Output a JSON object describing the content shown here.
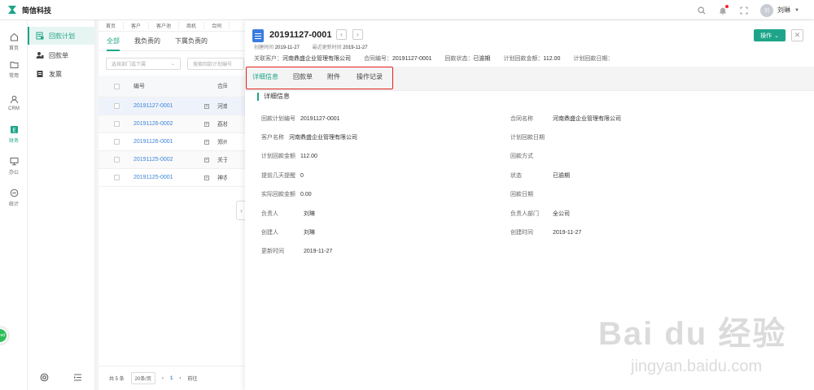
{
  "app": {
    "title": "简信科技"
  },
  "user": {
    "avatar_text": "刘",
    "name": "刘琳"
  },
  "rail": [
    {
      "label": "首页",
      "icon": "home-icon"
    },
    {
      "label": "常用",
      "icon": "folder-icon"
    },
    {
      "label": "CRM",
      "icon": "person-icon"
    },
    {
      "label": "财务",
      "icon": "finance-icon"
    },
    {
      "label": "办公",
      "icon": "monitor-icon"
    },
    {
      "label": "统计",
      "icon": "minus-circle-icon"
    }
  ],
  "chat_bubble": "ed",
  "subnav": [
    {
      "label": "回款计划",
      "active": true
    },
    {
      "label": "回款单"
    },
    {
      "label": "发票"
    }
  ],
  "breadcrumbs": [
    "首页",
    "客户",
    "客户池",
    "商机",
    "合同"
  ],
  "list_tabs": [
    "全部",
    "我负责的",
    "下属负责的"
  ],
  "filters": {
    "dept_placeholder": "选择部门或下属",
    "search_placeholder": "搜索回款计划编号"
  },
  "table": {
    "header": {
      "code": "编号",
      "name": "合同"
    },
    "rows": [
      {
        "code": "20191127-0001",
        "name": "河南"
      },
      {
        "code": "20191126-0002",
        "name": "荔枝"
      },
      {
        "code": "20191126-0001",
        "name": "郑州"
      },
      {
        "code": "20191125-0002",
        "name": "关于"
      },
      {
        "code": "20191125-0001",
        "name": "神农"
      }
    ]
  },
  "pager": {
    "total": "共 5 条",
    "page_size": "20条/页",
    "current_page": "1",
    "goto": "前往"
  },
  "detail": {
    "title": "20191127-0001",
    "created_label": "创建时间",
    "created_value": "2019-11-27",
    "updated_label": "最近更新时间",
    "updated_value": "2019-11-27",
    "op_button": "操作",
    "summary": {
      "customer_label": "关联客户：",
      "customer_value": "河南鼎盛企业管理有限公司",
      "contract_label": "合同编号：",
      "contract_value": "20191127-0001",
      "status_label": "回款状态：",
      "status_value": "已逾期",
      "amount_label": "计划回款金额：",
      "amount_value": "112.00",
      "date_label": "计划回款日期："
    },
    "tabs": [
      "详细信息",
      "回款单",
      "附件",
      "操作记录"
    ],
    "section_title": "详细信息",
    "fields_left": [
      {
        "label": "回款计划编号",
        "value": "20191127-0001"
      },
      {
        "label": "客户名称",
        "value": "河南鼎盛企业管理有限公司"
      },
      {
        "label": "计划回款金额",
        "value": "112.00"
      },
      {
        "label": "提前几天提醒",
        "value": "0"
      },
      {
        "label": "实际回款金额",
        "value": "0.00"
      },
      {
        "label": "负责人",
        "value": "刘琳"
      },
      {
        "label": "创建人",
        "value": "刘琳"
      },
      {
        "label": "更新时间",
        "value": "2019-11-27"
      }
    ],
    "fields_right": [
      {
        "label": "合同名称",
        "value": "河南鼎盛企业管理有限公司"
      },
      {
        "label": "计划回款日期",
        "value": ""
      },
      {
        "label": "回款方式",
        "value": ""
      },
      {
        "label": "状态",
        "value": "已逾期"
      },
      {
        "label": "回款日期",
        "value": ""
      },
      {
        "label": "负责人部门",
        "value": "全公司"
      },
      {
        "label": "创建时间",
        "value": "2019-11-27"
      }
    ]
  },
  "watermark": {
    "main": "Bai du 经验",
    "sub": "jingyan.baidu.com"
  }
}
